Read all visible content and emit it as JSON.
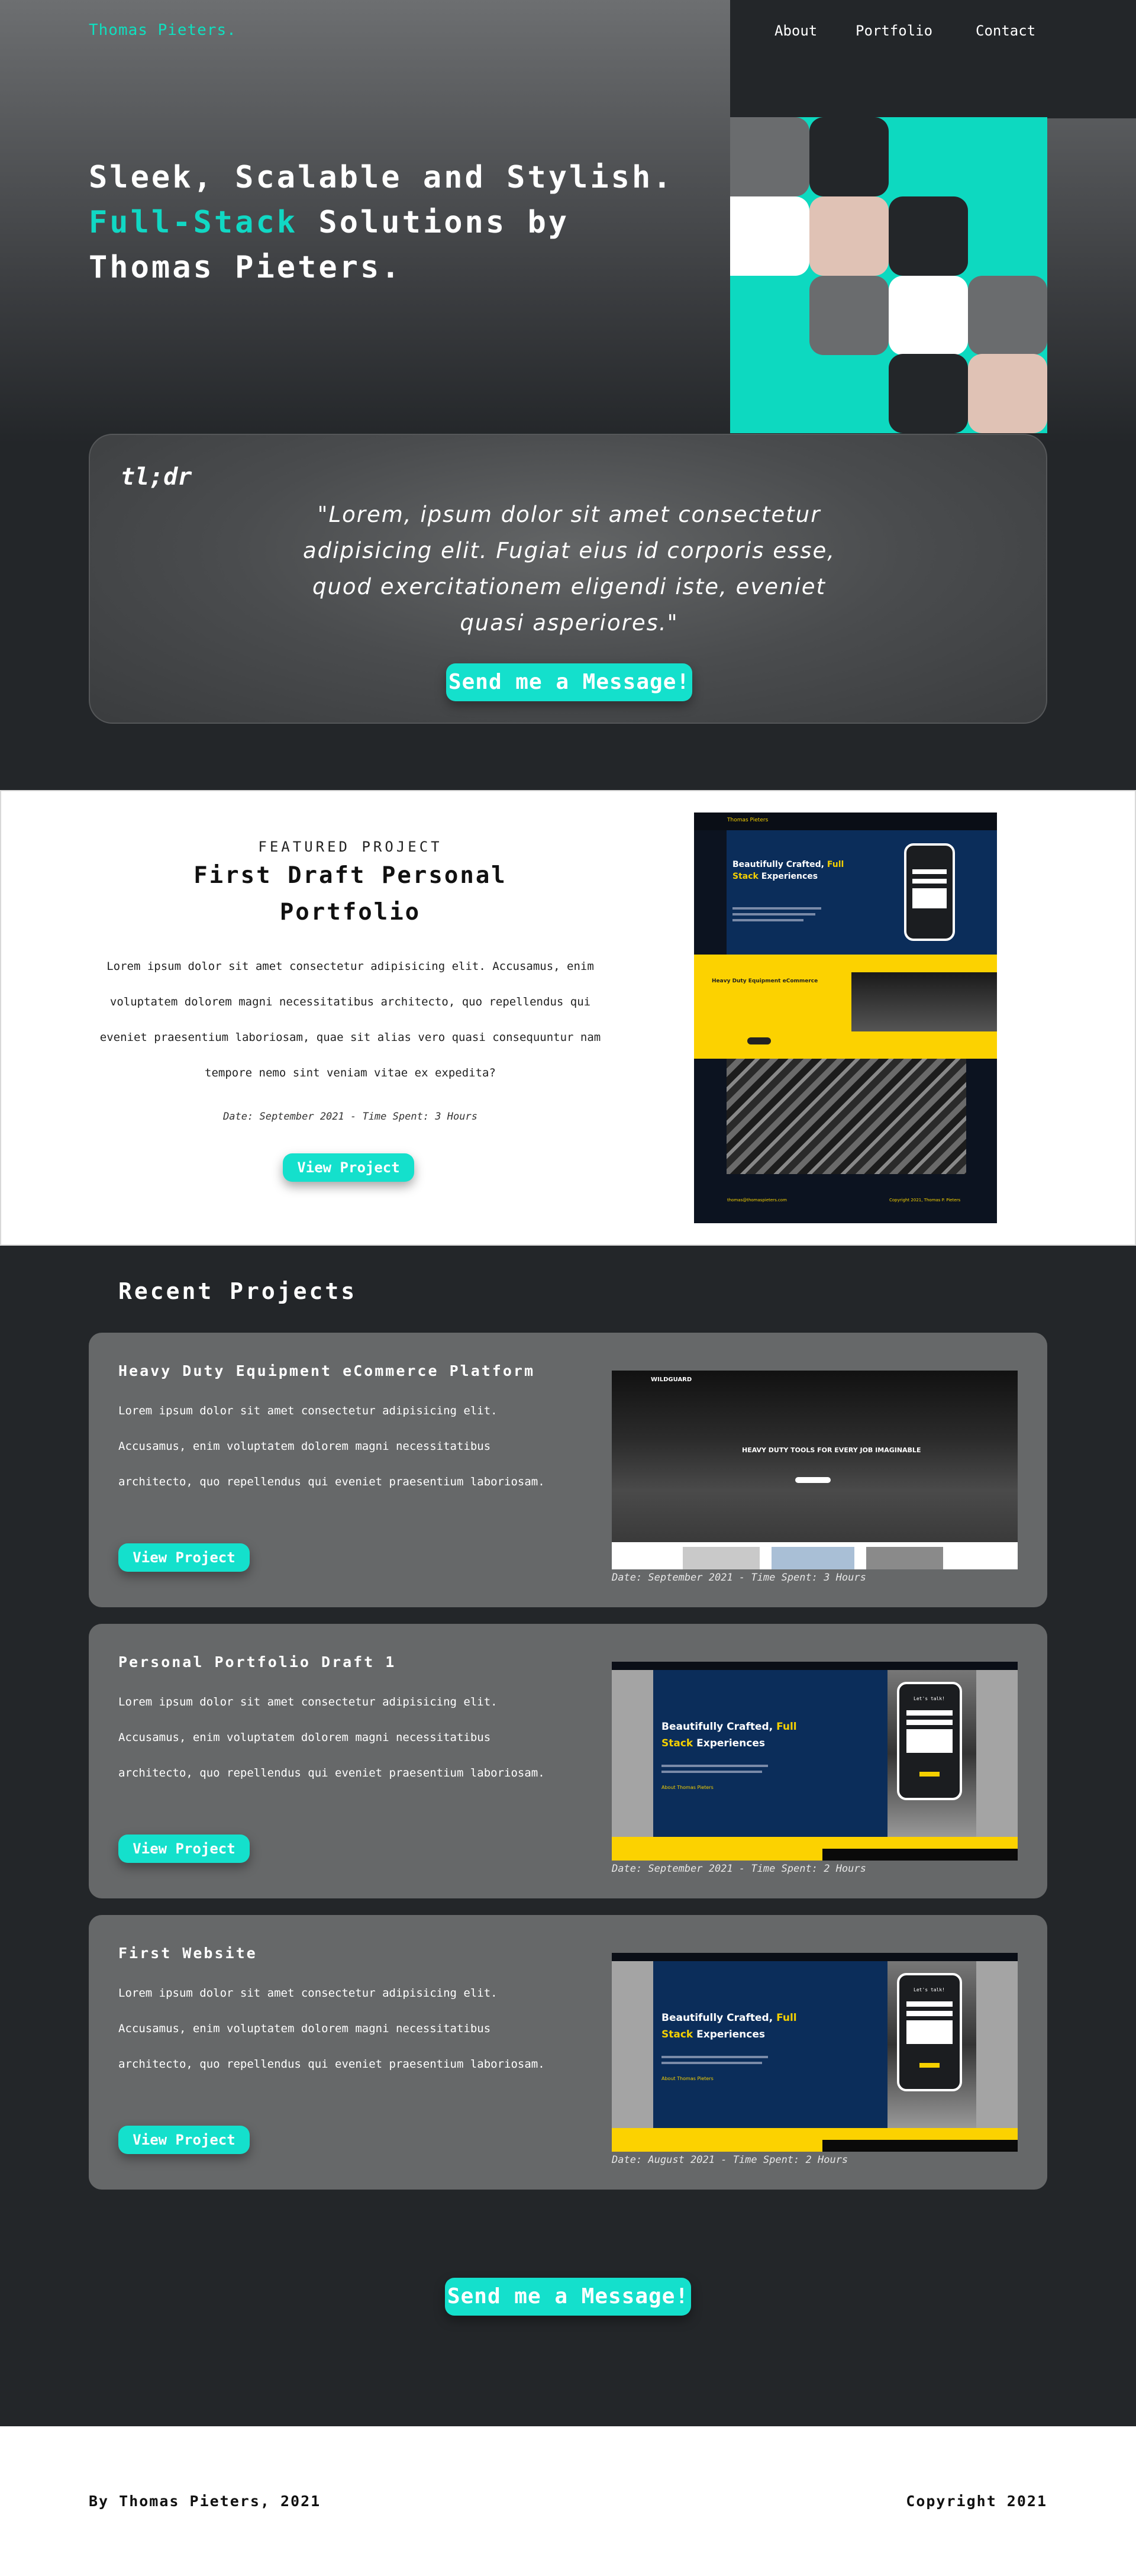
{
  "header": {
    "brand": "Thomas Pieters.",
    "nav": [
      "About",
      "Portfolio",
      "Contact"
    ]
  },
  "hero": {
    "line1": "Sleek, Scalable and Stylish.",
    "accent": "Full-Stack",
    "line2_rest": " Solutions by",
    "line3": "Thomas Pieters."
  },
  "colors": {
    "accent": "#14e0cc",
    "dark": "#232629",
    "gray": "#666869",
    "beige": "#e0c2b5",
    "white": "#ffffff"
  },
  "tldr": {
    "label": "tl;dr",
    "quote": "\"Lorem, ipsum dolor sit amet consectetur adipisicing elit. Fugiat eius id corporis esse, quod exercitationem eligendi iste, eveniet quasi asperiores.\"",
    "cta": "Send me a Message!"
  },
  "featured": {
    "kicker": "FEATURED PROJECT",
    "title": "First Draft Personal Portfolio",
    "description": "Lorem ipsum dolor sit amet consectetur adipisicing elit. Accusamus, enim voluptatem dolorem magni necessitatibus architecto, quo repellendus qui eveniet praesentium laboriosam, quae sit alias vero quasi consequuntur nam tempore nemo sint veniam vitae ex expedita?",
    "meta": "Date: September 2021 - Time Spent: 3 Hours",
    "button": "View Project"
  },
  "recent": {
    "title": "Recent Projects",
    "cards": [
      {
        "title": "Heavy Duty Equipment eCommerce Platform",
        "description": "Lorem ipsum dolor sit amet consectetur adipisicing elit. Accusamus, enim voluptatem dolorem magni necessitatibus architecto, quo repellendus qui eveniet praesentium laboriosam.",
        "meta": "Date: September 2021 - Time Spent: 3 Hours",
        "button": "View Project"
      },
      {
        "title": "Personal Portfolio Draft 1",
        "description": "Lorem ipsum dolor sit amet consectetur adipisicing elit. Accusamus, enim voluptatem dolorem magni necessitatibus architecto, quo repellendus qui eveniet praesentium laboriosam.",
        "meta": "Date: September 2021 - Time Spent: 2 Hours",
        "button": "View Project"
      },
      {
        "title": "First Website",
        "description": "Lorem ipsum dolor sit amet consectetur adipisicing elit. Accusamus, enim voluptatem dolorem magni necessitatibus architecto, quo repellendus qui eveniet praesentium laboriosam.",
        "meta": "Date: August 2021 - Time Spent: 2 Hours",
        "button": "View Project"
      }
    ]
  },
  "final_cta": "Send me a Message!",
  "footer": {
    "left": "By Thomas Pieters, 2021",
    "right": "Copyright 2021"
  },
  "mini": {
    "tp_brand": "Thomas Pieters",
    "hero_a": "Beautifully Crafted,",
    "hero_full": "Full",
    "hero_b": "Stack",
    "hero_c": "Experiences",
    "about": "About Thomas Pieters",
    "lets_talk": "Let's talk!",
    "hd_title": "Heavy Duty Equipment eCommerce",
    "hd_banner": "HEAVY DUTY TOOLS FOR EVERY JOB IMAGINABLE",
    "wildguard": "WILDGUARD",
    "email": "thomas@thomaspieters.com",
    "copyright": "Copyright 2021, Thomas P. Pieters"
  }
}
